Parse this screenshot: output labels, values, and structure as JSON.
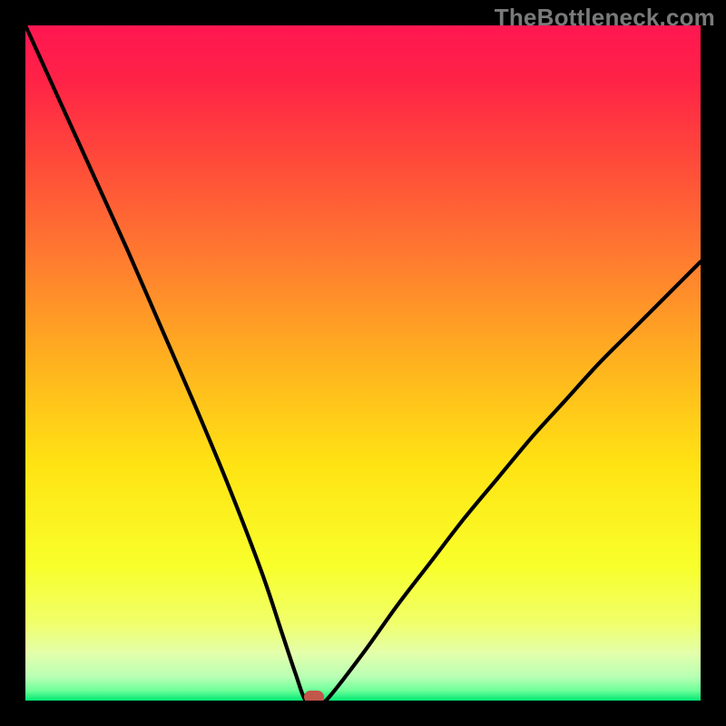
{
  "watermark": "TheBottleneck.com",
  "chart_data": {
    "type": "line",
    "title": "",
    "xlabel": "",
    "ylabel": "",
    "xlim": [
      0,
      100
    ],
    "ylim": [
      0,
      100
    ],
    "x": [
      0,
      5,
      10,
      15,
      20,
      25,
      30,
      35,
      38,
      40,
      41.5,
      43,
      44.5,
      50,
      55,
      60,
      65,
      70,
      75,
      80,
      85,
      90,
      95,
      100
    ],
    "y": [
      100,
      89,
      78,
      67,
      55.5,
      44,
      32,
      19,
      10,
      4,
      0,
      0,
      0,
      7,
      14,
      20.5,
      27,
      33,
      39,
      44.5,
      50,
      55,
      60,
      65
    ],
    "marker": {
      "x": 42.7,
      "y": 0.5
    },
    "background_gradient": {
      "stops": [
        {
          "pos": 0.0,
          "color": "#ff1751"
        },
        {
          "pos": 0.08,
          "color": "#ff2247"
        },
        {
          "pos": 0.2,
          "color": "#ff4a3a"
        },
        {
          "pos": 0.35,
          "color": "#ff7d2f"
        },
        {
          "pos": 0.5,
          "color": "#ffb21f"
        },
        {
          "pos": 0.65,
          "color": "#ffe313"
        },
        {
          "pos": 0.8,
          "color": "#f8ff2b"
        },
        {
          "pos": 0.885,
          "color": "#f0ff6a"
        },
        {
          "pos": 0.93,
          "color": "#e3ffab"
        },
        {
          "pos": 0.965,
          "color": "#b8ffb4"
        },
        {
          "pos": 0.985,
          "color": "#6fff9a"
        },
        {
          "pos": 1.0,
          "color": "#00e873"
        }
      ]
    }
  }
}
